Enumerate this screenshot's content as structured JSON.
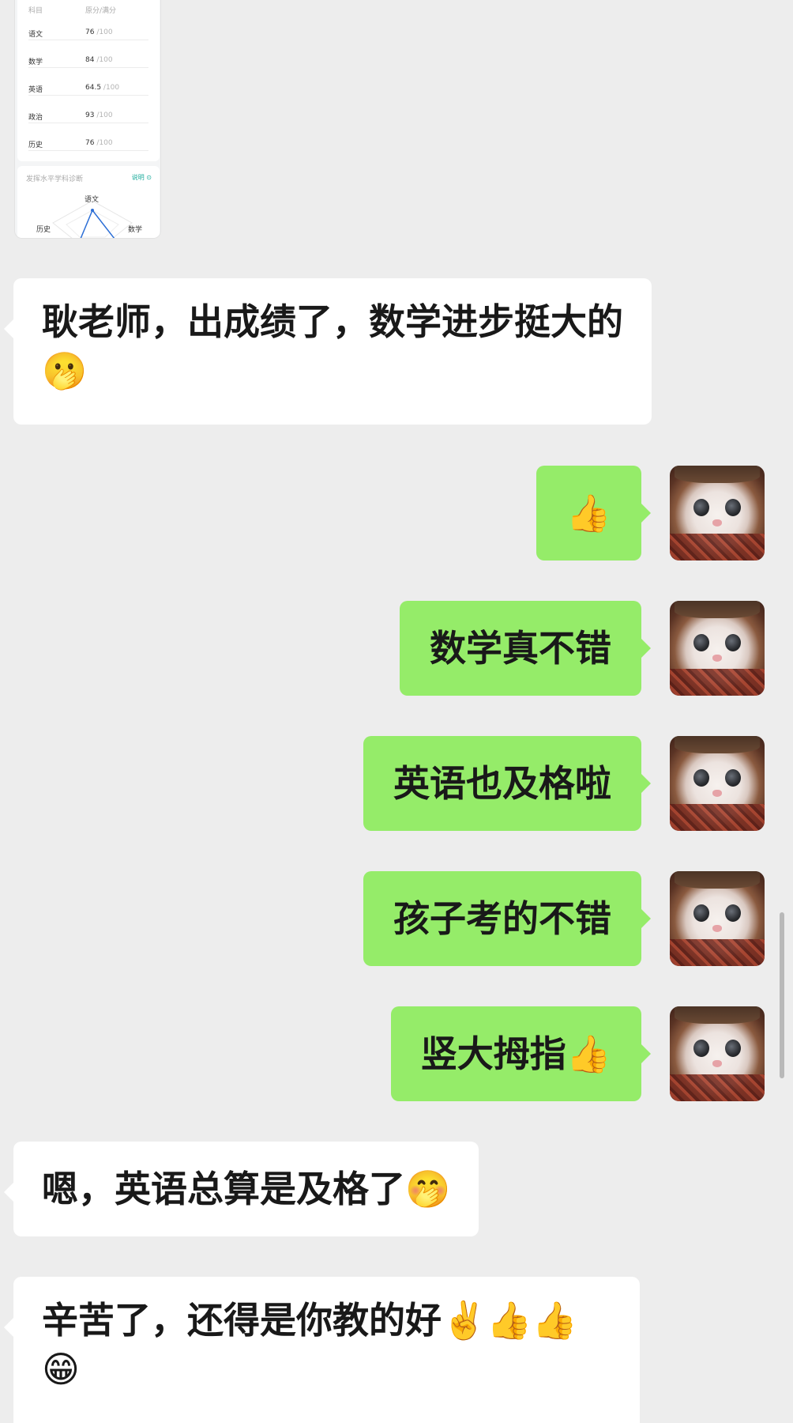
{
  "score_card": {
    "header": {
      "subject_col": "科目",
      "score_col": "原分/满分"
    },
    "rows": [
      {
        "subject": "语文",
        "score": "76",
        "max": "/100"
      },
      {
        "subject": "数学",
        "score": "84",
        "max": "/100"
      },
      {
        "subject": "英语",
        "score": "64.5",
        "max": "/100"
      },
      {
        "subject": "政治",
        "score": "93",
        "max": "/100"
      },
      {
        "subject": "历史",
        "score": "76",
        "max": "/100"
      }
    ],
    "diagnosis": {
      "title": "发挥水平学科诊断",
      "link": "说明 ⊙",
      "radar_labels": {
        "top": "语文",
        "left": "历史",
        "right": "数学"
      }
    }
  },
  "messages": [
    {
      "side": "left",
      "text": "耿老师，出成绩了，数学进步挺大的🫢"
    },
    {
      "side": "right",
      "text": "👍"
    },
    {
      "side": "right",
      "text": "数学真不错"
    },
    {
      "side": "right",
      "text": "英语也及格啦"
    },
    {
      "side": "right",
      "text": "孩子考的不错"
    },
    {
      "side": "right",
      "text": "竖大拇指👍"
    },
    {
      "side": "left",
      "text": "嗯，英语总算是及格了🤭"
    },
    {
      "side": "left",
      "text": "辛苦了，还得是你教的好✌️👍👍😁"
    }
  ],
  "colors": {
    "background": "#ededed",
    "left_bubble": "#ffffff",
    "right_bubble": "#95ec69"
  },
  "icons": {
    "avatar": "cat-avatar-image"
  }
}
